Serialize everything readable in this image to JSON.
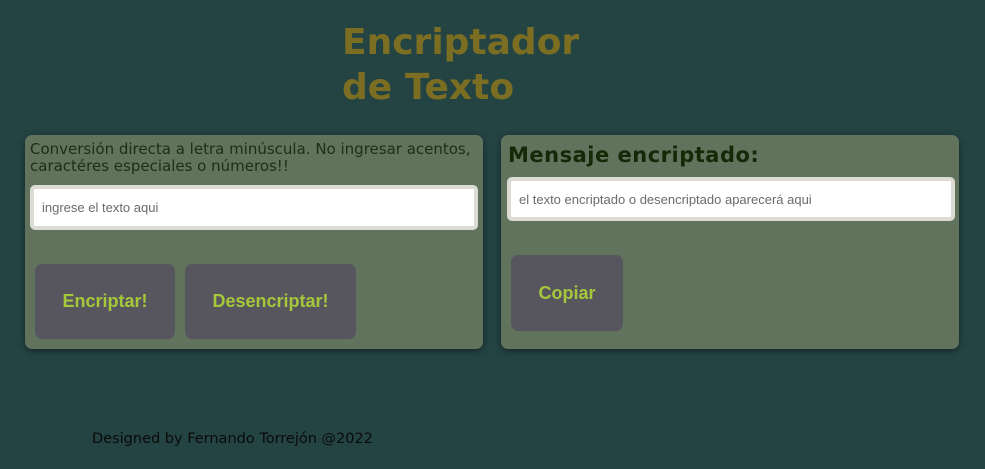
{
  "header": {
    "title_line1": "Encriptador",
    "title_line2": "de Texto"
  },
  "input_panel": {
    "hint": "Conversión directa a letra minúscula. No ingresar acentos, caractéres especiales o números!!",
    "input_placeholder": "ingrese el texto aqui",
    "input_value": "",
    "encrypt_label": "Encriptar!",
    "decrypt_label": "Desencriptar!"
  },
  "output_panel": {
    "heading": "Mensaje encriptado:",
    "output_placeholder": "el texto encriptado o desencriptado aparecerá aqui",
    "output_value": "",
    "copy_label": "Copiar"
  },
  "footer": {
    "text": "Designed by Fernando Torrejón @2022"
  },
  "colors": {
    "background": "#244443",
    "panel": "#61735d",
    "title": "#7b6e22",
    "button": "#57565e",
    "button_text": "#a5c73a"
  }
}
